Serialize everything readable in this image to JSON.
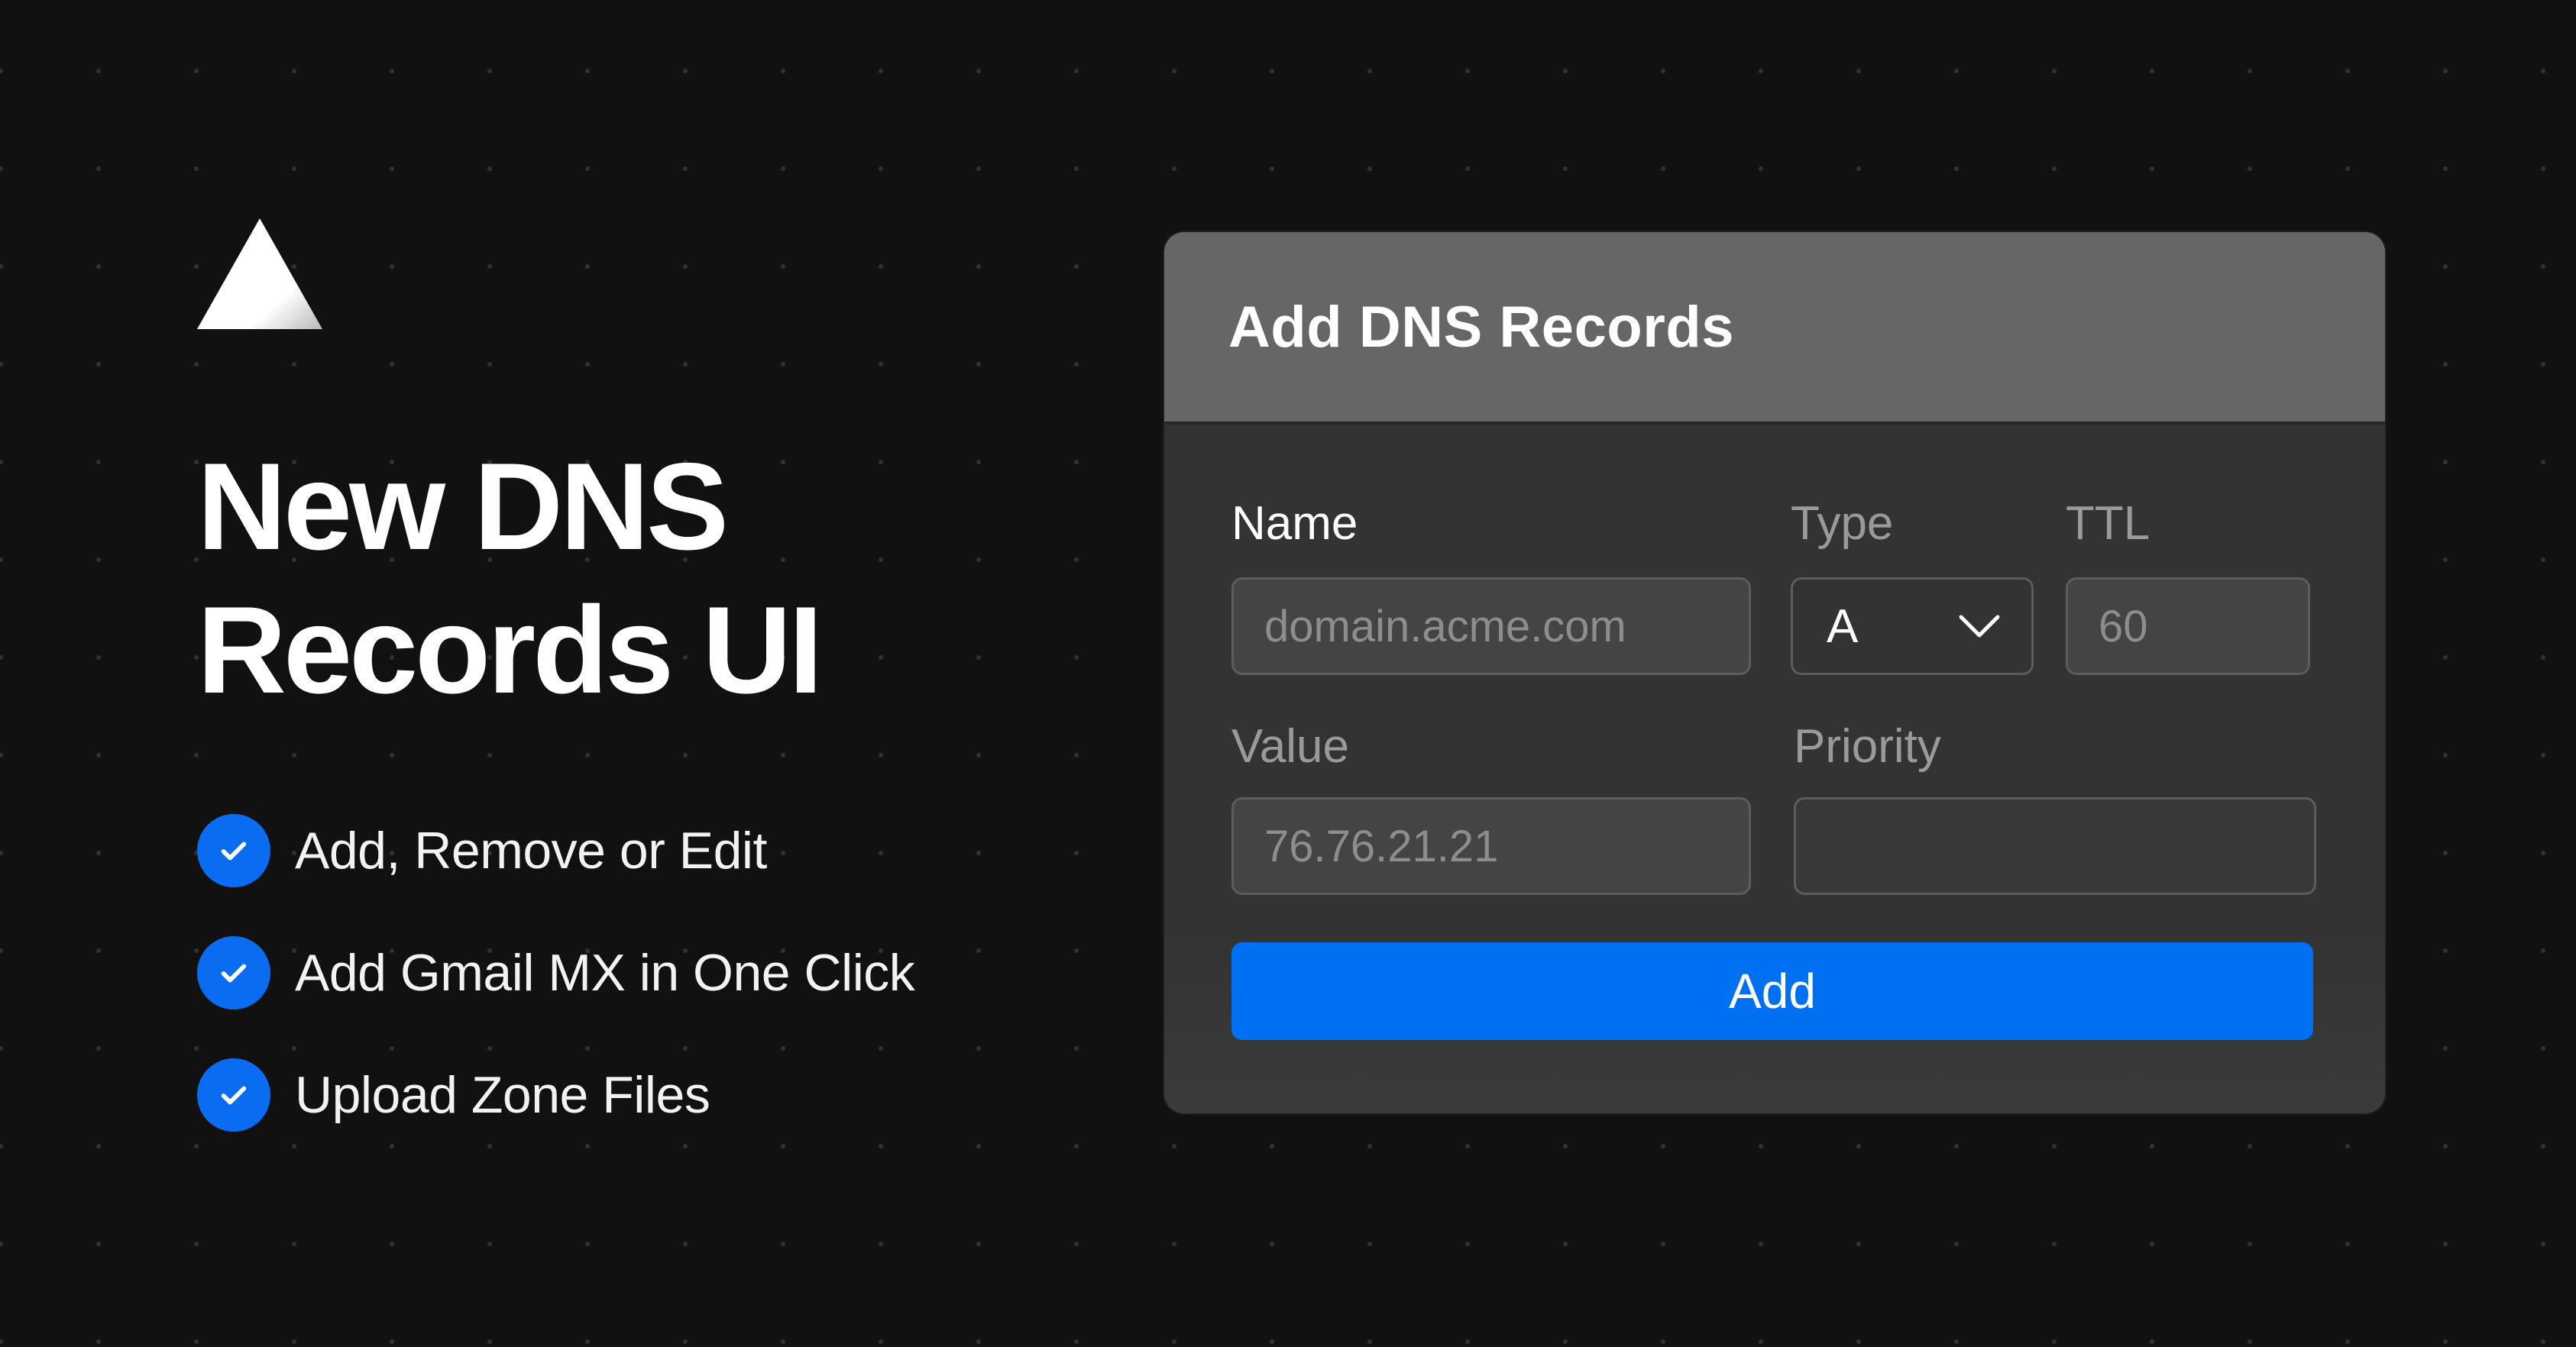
{
  "hero": {
    "logo_icon": "triangle-logo-icon",
    "title_line1": "New DNS",
    "title_line2": "Records UI"
  },
  "features": [
    {
      "icon": "check-circle-icon",
      "label": "Add, Remove or Edit"
    },
    {
      "icon": "check-circle-icon",
      "label": "Add Gmail MX in One Click"
    },
    {
      "icon": "check-circle-icon",
      "label": "Upload Zone Files"
    }
  ],
  "card": {
    "title": "Add DNS Records",
    "fields": {
      "name": {
        "label": "Name",
        "placeholder": "domain.acme.com"
      },
      "type": {
        "label": "Type",
        "value": "A",
        "icon": "chevron-down-icon"
      },
      "ttl": {
        "label": "TTL",
        "placeholder": "60"
      },
      "value": {
        "label": "Value",
        "placeholder": "76.76.21.21"
      },
      "priority": {
        "label": "Priority",
        "placeholder": ""
      }
    },
    "submit_label": "Add"
  },
  "colors": {
    "background": "#111111",
    "card_header": "#666666",
    "card_body": "#333333",
    "accent": "#0070f3",
    "check_badge": "#0a6cf0"
  }
}
